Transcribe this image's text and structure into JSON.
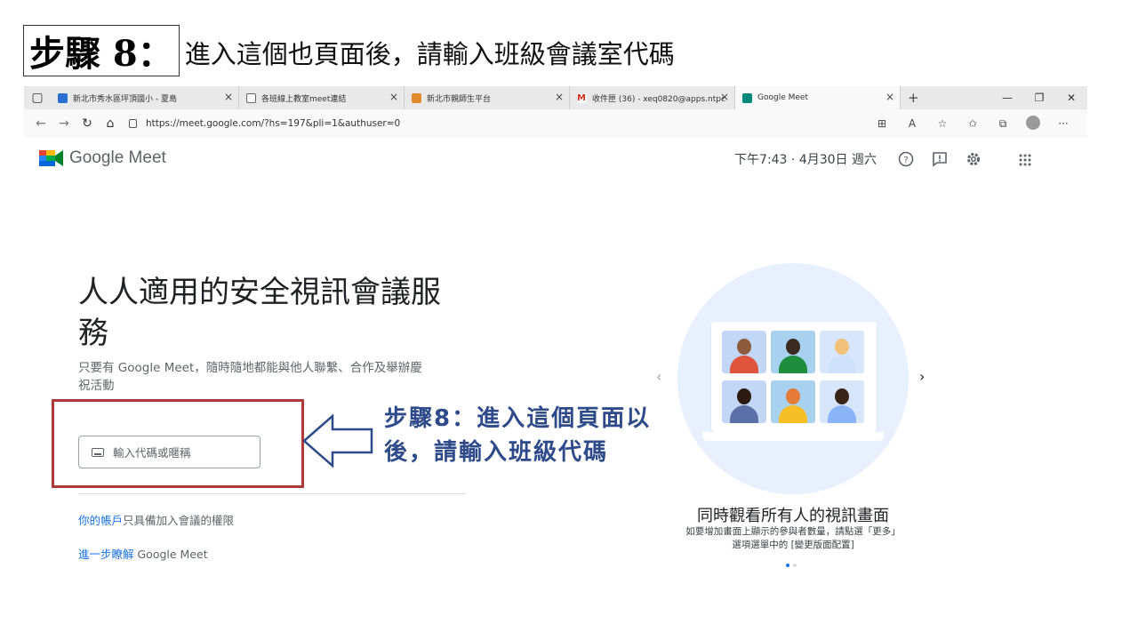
{
  "slide": {
    "step_label": "步驟 8：",
    "step_desc": "進入這個也頁面後，請輸入班級會議室代碼"
  },
  "browser": {
    "tabs": [
      {
        "label": "新北市秀水區坪頂國小 - 夏島",
        "icon": "bing-icon",
        "color": "#2a6fd6"
      },
      {
        "label": "各班線上教室meet連結",
        "icon": "document-icon",
        "color": "#666666"
      },
      {
        "label": "新北市親師生平台",
        "icon": "school-icon",
        "color": "#e08a2c"
      },
      {
        "label": "收件匣 (36) - xeq0820@apps.ntpc",
        "icon": "gmail-icon",
        "color": "#d93025"
      },
      {
        "label": "Google Meet",
        "icon": "meet-icon",
        "color": "#00897b"
      }
    ],
    "url": "https://meet.google.com/?hs=197&pli=1&authuser=0"
  },
  "meet": {
    "brand": "Google Meet",
    "datetime": "下午7:43 · 4月30日 週六",
    "headline": "人人適用的安全視訊會議服務",
    "subtext": "只要有 Google Meet，隨時隨地都能與他人聯繫、合作及舉辦慶祝活動",
    "code_placeholder": "輸入代碼或暱稱",
    "notice_link": "你的帳戶",
    "notice_rest": "只具備加入會議的權限",
    "learn_link": "進一步瞭解",
    "learn_rest": " Google Meet",
    "slide_title": "同時觀看所有人的視訊畫面",
    "slide_desc_line1": "如要增加畫面上顯示的參與者數量，請點選「更多」",
    "slide_desc_line2": "選項選單中的 [變更版面配置]"
  },
  "annotation": {
    "line1": "步驟8：進入這個頁面以",
    "line2": "後，請輸入班級代碼"
  },
  "colors": {
    "highlight_box": "#b03a3a",
    "annotation_text": "#2e4a8a",
    "link": "#1a73e8"
  }
}
